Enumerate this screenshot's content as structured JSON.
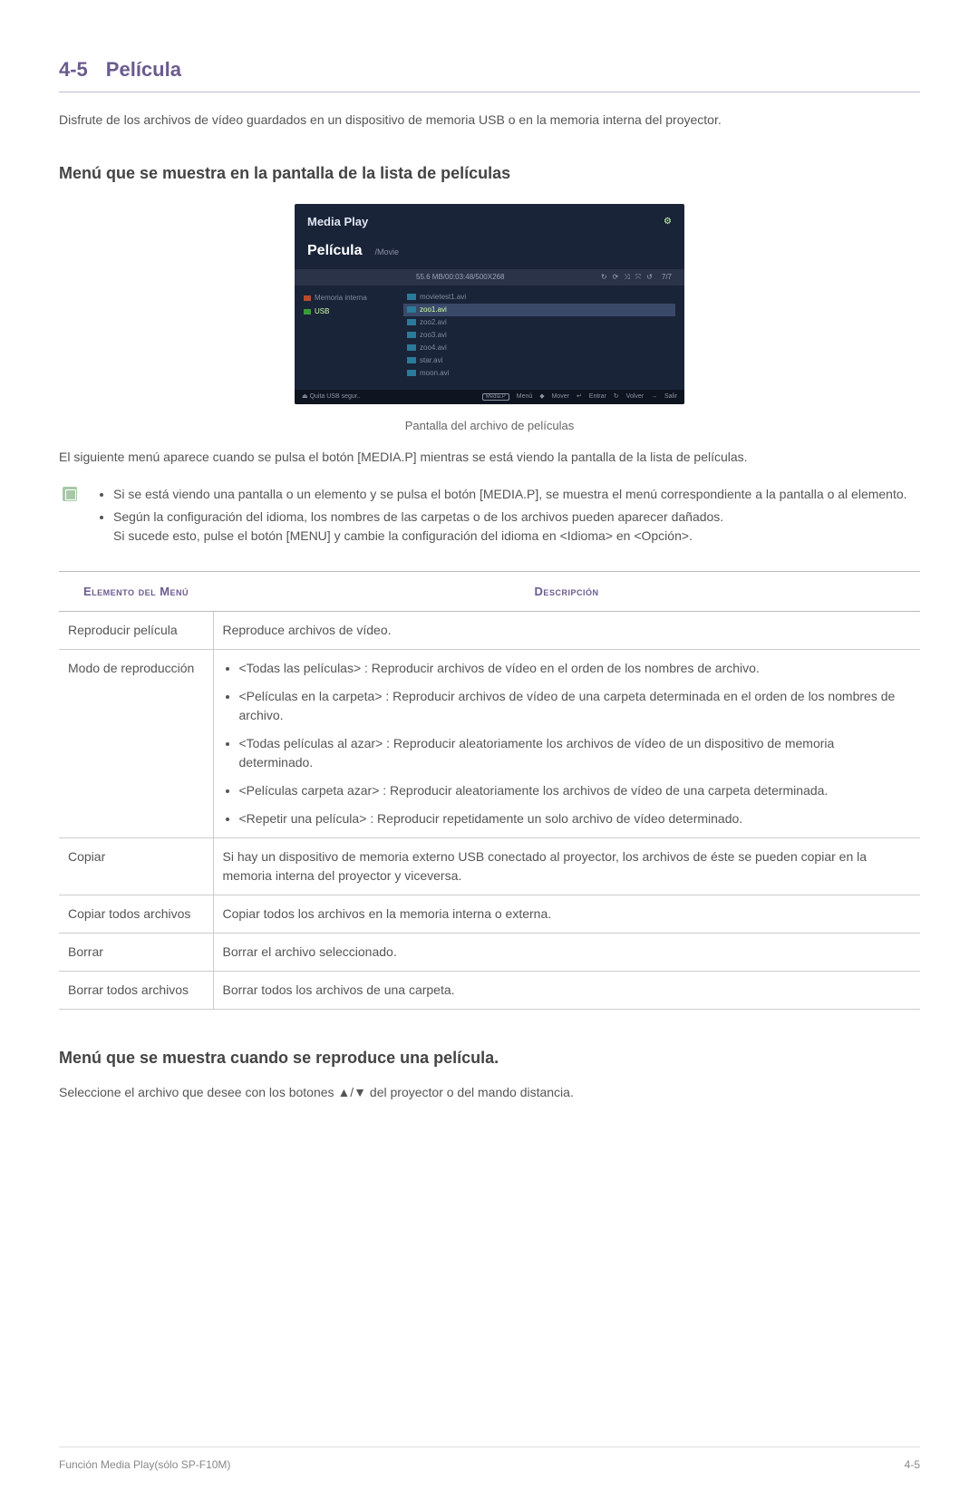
{
  "section": {
    "num": "4-5",
    "title": "Película"
  },
  "intro": "Disfrute de los archivos de vídeo guardados en un dispositivo de memoria USB o en la memoria interna del proyector.",
  "sub1": "Menú que se muestra en la pantalla de la lista de películas",
  "screenshot": {
    "media_play": "Media Play",
    "pel": "Película",
    "path": "/Movie",
    "status_left": "55.6 MB/00:03:48/500X268",
    "count": "7/7",
    "side": {
      "internal": "Memoria interna",
      "usb": "USB"
    },
    "files": [
      "movietest1.avi",
      "zoo1.avi",
      "zoo2.avi",
      "zoo3.avi",
      "zoo4.avi",
      "star.avi",
      "moon.avi"
    ],
    "foot_left": "Quita USB segur..",
    "foot_btn": "Media.P",
    "foot_menu": "Menú",
    "foot_mover": "Mover",
    "foot_entrar": "Entrar",
    "foot_volver": "Volver",
    "foot_salir": "Salir"
  },
  "caption": "Pantalla del archivo de películas",
  "para1": "El siguiente menú aparece cuando se pulsa el botón [MEDIA.P] mientras se está viendo la pantalla de la lista de películas.",
  "notes": {
    "n1": "Si se está viendo una pantalla o un elemento y se pulsa el botón [MEDIA.P], se muestra el menú correspondiente a la pantalla o al elemento.",
    "n2a": "Según la configuración del idioma, los nombres de las carpetas o de los archivos pueden aparecer dañados.",
    "n2b": "Si sucede esto, pulse el botón [MENU] y cambie la configuración del idioma en <Idioma> en <Opción>."
  },
  "table": {
    "h1": "Elemento del Menú",
    "h2": "Descripción",
    "rows": [
      {
        "item": "Reproducir película",
        "desc": "Reproduce archivos de vídeo."
      },
      {
        "item": "Modo de reproducción",
        "list": [
          "<Todas las películas> : Reproducir archivos de vídeo en el orden de los nombres de archivo.",
          "<Películas en la carpeta> : Reproducir archivos de vídeo de una carpeta determinada en el orden de los nombres de archivo.",
          "<Todas películas al azar> : Reproducir aleatoriamente los archivos de vídeo de un dispositivo de memoria determinado.",
          "<Películas carpeta azar> : Reproducir aleatoriamente los archivos de vídeo de una carpeta determinada.",
          "<Repetir una película> : Reproducir repetidamente un solo archivo de vídeo determinado."
        ]
      },
      {
        "item": "Copiar",
        "desc": "Si hay un dispositivo de memoria externo USB conectado al proyector, los archivos de éste se pueden copiar en la memoria interna del proyector y viceversa."
      },
      {
        "item": "Copiar todos archivos",
        "desc": "Copiar todos los archivos en la memoria interna o externa."
      },
      {
        "item": "Borrar",
        "desc": "Borrar el archivo seleccionado."
      },
      {
        "item": "Borrar todos archivos",
        "desc": "Borrar todos los archivos de una carpeta."
      }
    ]
  },
  "sub2": "Menú que se muestra cuando se reproduce una película.",
  "para2_pre": "Seleccione el archivo que desee con los botones ",
  "para2_post": " del proyector o del mando distancia.",
  "arrows": "▲/▼",
  "footer": {
    "left": "Función Media Play(sólo SP-F10M)",
    "right": "4-5"
  }
}
